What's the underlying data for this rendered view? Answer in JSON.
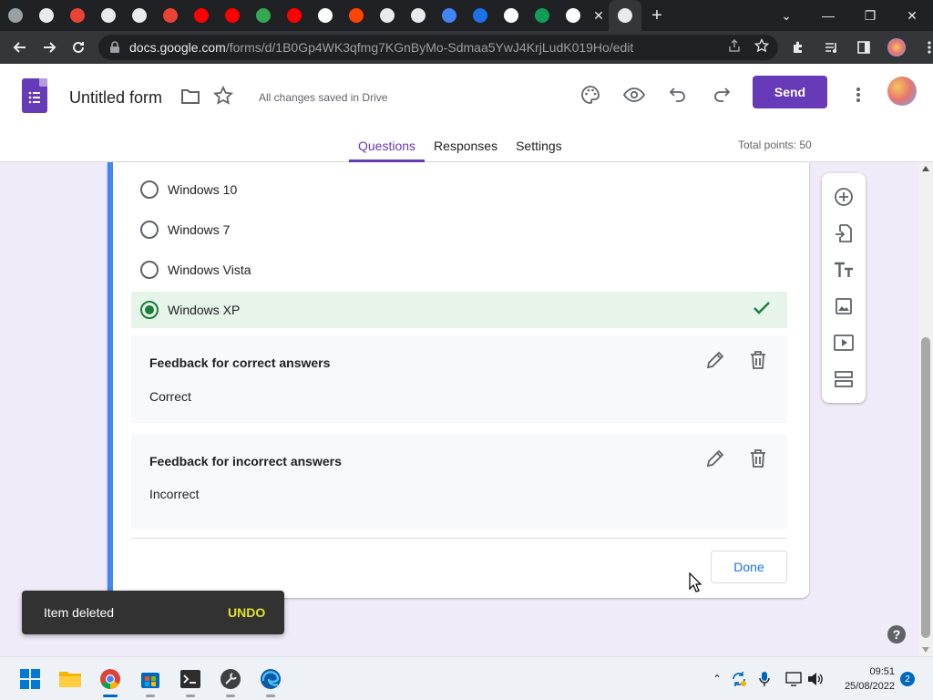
{
  "browser": {
    "tabs": [
      {
        "icon": "generic-page-icon",
        "color": "#9aa0a6"
      },
      {
        "icon": "globe-icon",
        "color": "#e8eaed"
      },
      {
        "icon": "app-icon",
        "color": "#ea4335"
      },
      {
        "icon": "chrome-icon",
        "color": "#e8eaed"
      },
      {
        "icon": "globe-icon",
        "color": "#e8eaed"
      },
      {
        "icon": "record-icon",
        "color": "#ea4335"
      },
      {
        "icon": "youtube-icon",
        "color": "#ff0000"
      },
      {
        "icon": "youtube-icon",
        "color": "#ff0000"
      },
      {
        "icon": "bird-icon",
        "color": "#34a853"
      },
      {
        "icon": "youtube-icon",
        "color": "#ff0000"
      },
      {
        "icon": "google-icon",
        "color": "#ffffff"
      },
      {
        "icon": "reddit-icon",
        "color": "#ff4500"
      },
      {
        "icon": "globe-icon",
        "color": "#e8eaed"
      },
      {
        "icon": "chrome-icon",
        "color": "#e8eaed"
      },
      {
        "icon": "docs-icon",
        "color": "#4285f4"
      },
      {
        "icon": "link-icon",
        "color": "#1a73e8"
      },
      {
        "icon": "google-icon",
        "color": "#ffffff"
      },
      {
        "icon": "chat-icon",
        "color": "#0f9d58"
      },
      {
        "icon": "google-icon",
        "color": "#ffffff"
      },
      {
        "icon": "globe-icon",
        "color": "#e8eaed"
      }
    ],
    "url_host": "docs.google.com",
    "url_path": "/forms/d/1B0Gp4WK3qfmg7KGnByMo-Sdmaa5YwJ4KrjLudK019Ho/edit"
  },
  "header": {
    "title": "Untitled form",
    "save_status": "All changes saved in Drive",
    "send_label": "Send",
    "tabs": [
      "Questions",
      "Responses",
      "Settings"
    ],
    "total_points": "Total points: 50"
  },
  "question": {
    "options": [
      "Windows 10",
      "Windows 7",
      "Windows Vista",
      "Windows XP"
    ],
    "correct_option": "Windows XP",
    "feedback_correct": {
      "title": "Feedback for correct answers",
      "text": "Correct"
    },
    "feedback_incorrect": {
      "title": "Feedback for incorrect answers",
      "text": "Incorrect"
    },
    "done_label": "Done"
  },
  "snackbar": {
    "message": "Item deleted",
    "action": "UNDO"
  },
  "taskbar": {
    "time": "09:51",
    "date": "25/08/2022",
    "notifications": "2"
  },
  "colors": {
    "accent": "#673ab7",
    "question_accent": "#4285f4",
    "correct": "#188038",
    "correct_bg": "#e6f4ea"
  }
}
